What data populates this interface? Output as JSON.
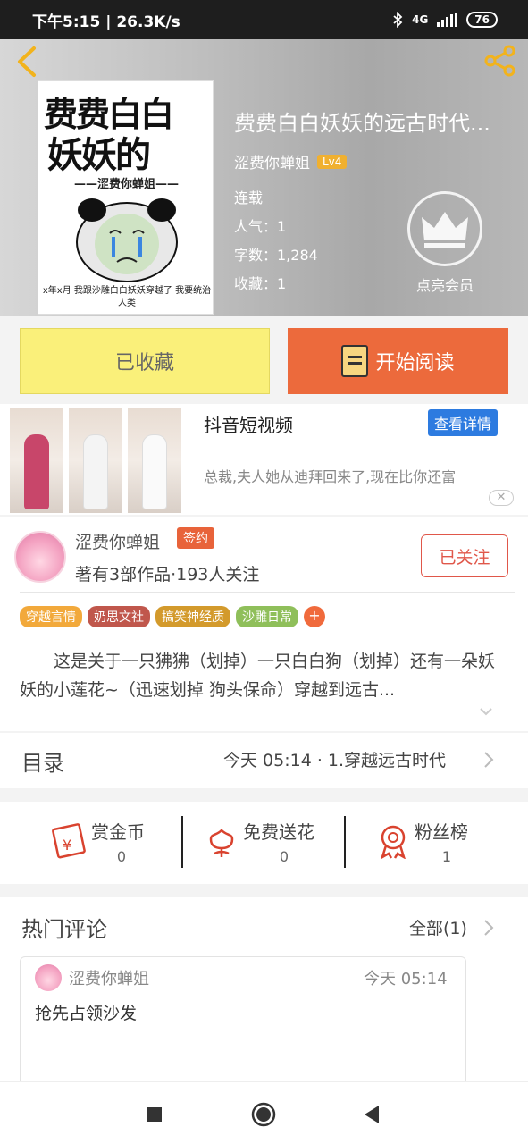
{
  "status_bar": {
    "time_speed": "下午5:15 | 26.3K/s",
    "network": "4G",
    "battery": "76"
  },
  "book": {
    "title": "费费白白妖妖的远古时代...",
    "author": "涩费你蝉姐",
    "level": "Lv4",
    "status": "连载",
    "popularity": "人气：1",
    "word_count": "字数：1,284",
    "favorites": "收藏：1",
    "vip_label": "点亮会员",
    "cover": {
      "line1": "费费白白",
      "line2": "妖妖的",
      "author": "——涩费你蝉姐——",
      "caption": "x年x月 我跟沙雕白白妖妖穿越了 我要统治人类"
    }
  },
  "actions": {
    "collect_label": "已收藏",
    "read_label": "开始阅读"
  },
  "ad": {
    "title": "抖音短视频",
    "more_label": "查看详情",
    "desc": "总裁,夫人她从迪拜回来了,现在比你还富",
    "close": "✕"
  },
  "author_card": {
    "name": "涩费你蝉姐",
    "badge": "签约",
    "meta": "著有3部作品·193人关注",
    "follow_label": "已关注",
    "tags": [
      "穿越言情",
      "奶思文社",
      "搞笑神经质",
      "沙雕日常"
    ],
    "tag_colors": [
      "#f2a93b",
      "#c0574c",
      "#d39a2c",
      "#8fbf5a"
    ],
    "tag_add": "+",
    "intro": "这是关于一只狒狒（划掉）一只白白狗（划掉）还有一朵妖妖的小莲花~（迅速划掉 狗头保命）穿越到远古..."
  },
  "catalog": {
    "label": "目录",
    "latest": "今天 05:14 · 1.穿越远古时代"
  },
  "gifts": [
    {
      "name": "赏金币",
      "count": "0",
      "icon": "red-envelope-icon"
    },
    {
      "name": "免费送花",
      "count": "0",
      "icon": "flower-icon"
    },
    {
      "name": "粉丝榜",
      "count": "1",
      "icon": "medal-icon"
    }
  ],
  "comments": {
    "label": "热门评论",
    "all_label": "全部(1)",
    "items": [
      {
        "user": "涩费你蝉姐",
        "time": "今天 05:14",
        "text": "抢先占领沙发"
      }
    ]
  },
  "colors": {
    "accent_orange": "#ec6a3c",
    "collect_yellow": "#faf07a",
    "ad_blue": "#2d7be0",
    "follow_red": "#e0574a"
  }
}
